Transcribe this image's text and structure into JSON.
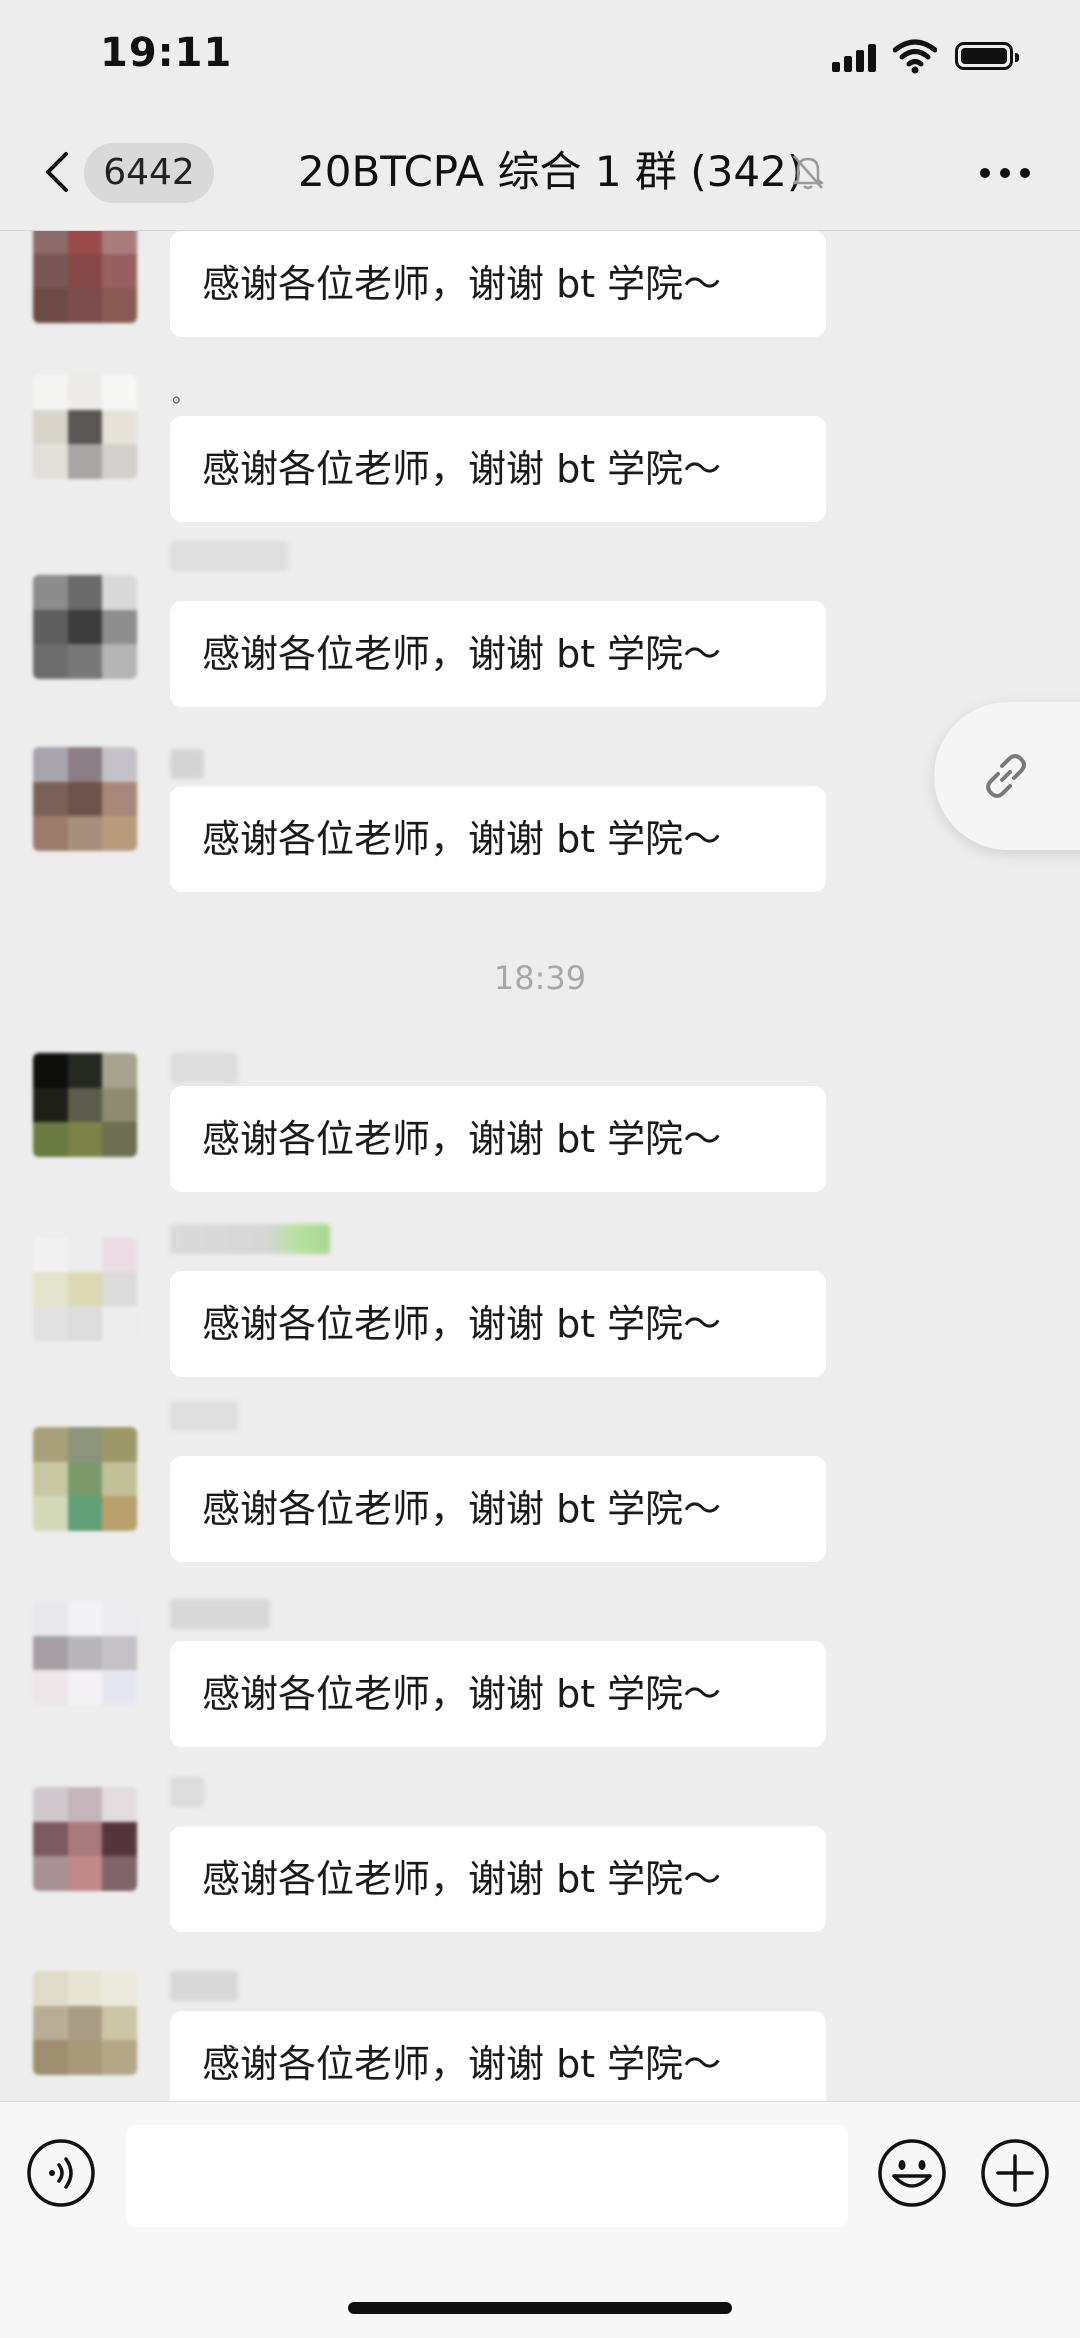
{
  "status_bar": {
    "time": "19:11"
  },
  "nav": {
    "unread_count": "6442",
    "title": "20BTCPA 综合 1 群 (342)"
  },
  "messages": [
    {
      "text": "感谢各位老师，谢谢 bt 学院～"
    },
    {
      "text": "感谢各位老师，谢谢 bt 学院～",
      "prefix": "。"
    },
    {
      "text": "感谢各位老师，谢谢 bt 学院～"
    },
    {
      "text": "感谢各位老师，谢谢 bt 学院～"
    },
    {
      "text": "感谢各位老师，谢谢 bt 学院～"
    },
    {
      "text": "感谢各位老师，谢谢 bt 学院～"
    },
    {
      "text": "感谢各位老师，谢谢 bt 学院～"
    },
    {
      "text": "感谢各位老师，谢谢 bt 学院～"
    },
    {
      "text": "感谢各位老师，谢谢 bt 学院～"
    },
    {
      "text": "感谢各位老师，谢谢 bt 学院～"
    }
  ],
  "time_separator": "18:39",
  "icons": {
    "back": "chevron-left-icon",
    "mute": "bell-slash-icon",
    "more": "more-dots-icon",
    "link": "link-icon",
    "voice": "voice-icon",
    "emoji": "smiley-icon",
    "plus": "plus-icon"
  },
  "colors": {
    "background": "#ededed",
    "bubble": "#ffffff",
    "badge": "#d9d9d9",
    "input_bar": "#f7f7f7"
  }
}
